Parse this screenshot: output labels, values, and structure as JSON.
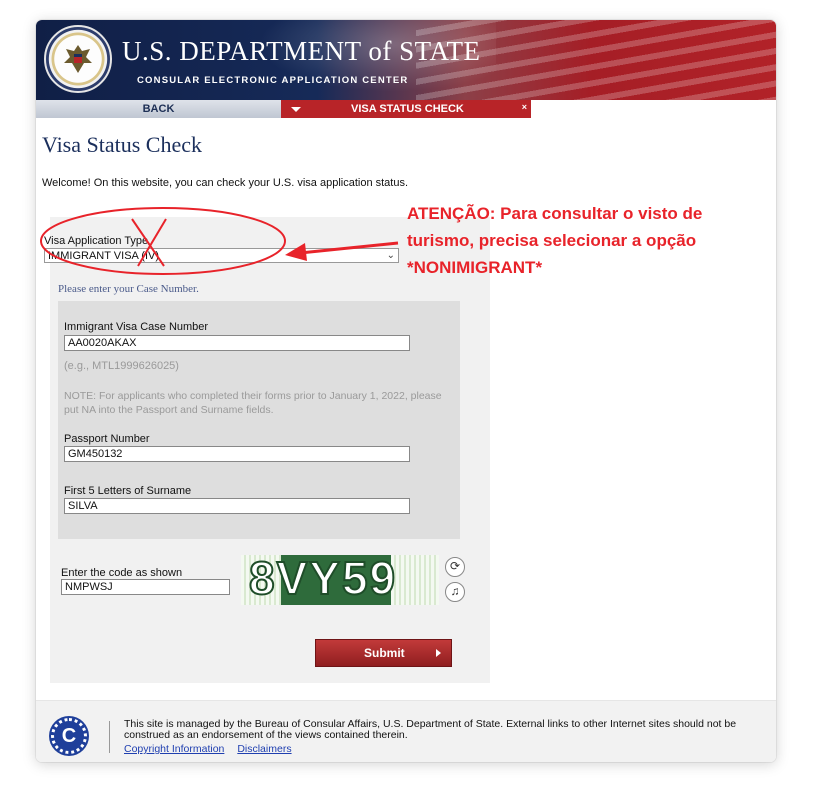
{
  "header": {
    "title_main": "U.S. DEPARTMENT of STATE",
    "title_sub": "CONSULAR ELECTRONIC APPLICATION CENTER",
    "seal_icon": "eagle-seal-icon"
  },
  "nav": {
    "back_label": "BACK",
    "status_label": "VISA STATUS CHECK",
    "close_glyph": "×"
  },
  "page": {
    "title": "Visa Status Check",
    "welcome": "Welcome! On this website, you can check your U.S. visa application status."
  },
  "form": {
    "type_label": "Visa Application Type",
    "type_value": "IMMIGRANT VISA (IV)",
    "case_hint": "Please enter your Case Number.",
    "case_label": "Immigrant Visa Case Number",
    "case_value": "AA0020AKAX",
    "case_example": "(e.g., MTL1999626025)",
    "note": "NOTE: For applicants who completed their forms prior to January 1, 2022, please put NA into the Passport and Surname fields.",
    "passport_label": "Passport Number",
    "passport_value": "GM450132",
    "surname_label": "First 5 Letters of Surname",
    "surname_value": "SILVA",
    "captcha_label": "Enter the code as shown",
    "captcha_value": "NMPWSJ",
    "captcha_image_text": "8VY59",
    "submit_label": "Submit"
  },
  "footer": {
    "logo_letter": "C",
    "text": "This site is managed by the Bureau of Consular Affairs, U.S. Department of State. External links to other Internet sites should not be construed as an endorsement of the views contained therein.",
    "link_copyright": "Copyright Information",
    "link_disclaimers": "Disclaimers"
  },
  "annotation": {
    "text": "ATENÇÃO: Para consultar o visto de turismo, precisa selecionar a opção *NONIMIGRANT*",
    "color": "#e8232a"
  },
  "colors": {
    "navy": "#1b2f5c",
    "red": "#b82428",
    "link": "#1f3fb0"
  }
}
